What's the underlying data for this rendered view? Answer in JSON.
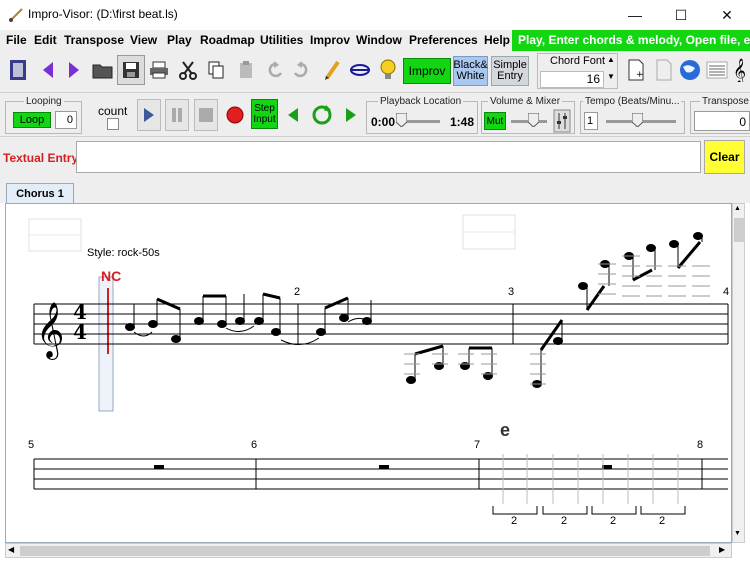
{
  "window": {
    "title": "Impro-Visor: (D:\\first beat.ls)",
    "minimize": "—",
    "maximize": "☐",
    "close": "✕"
  },
  "menu": {
    "items": [
      "File",
      "Edit",
      "Transpose",
      "View",
      "Play",
      "Roadmap",
      "Utilities",
      "Improv",
      "Window",
      "Preferences",
      "Help"
    ],
    "status": "Play, Enter chords & melody, Open file, etc."
  },
  "toolbar": {
    "improv_label": "Improv",
    "bw_label_1": "Black&",
    "bw_label_2": "White",
    "simple_label_1": "Simple",
    "simple_label_2": "Entry",
    "chord_font_label": "Chord Font",
    "chord_font_value": "16"
  },
  "playback": {
    "looping_label": "Looping",
    "loop_button": "Loop",
    "loop_count": "0",
    "count_label": "count",
    "step_input_1": "Step",
    "step_input_2": "Input",
    "location_label": "Playback Location",
    "time_current": "0:00",
    "time_total": "1:48",
    "volume_label": "Volume & Mixer",
    "mute_label": "Mut",
    "tempo_label": "Tempo (Beats/Minu...",
    "tempo_value": "1",
    "transpose_label": "Transpose",
    "transpose_value": "0"
  },
  "textual_entry": {
    "label": "Textual Entry",
    "value": "",
    "clear_button": "Clear"
  },
  "tabs": [
    "Chorus 1"
  ],
  "score": {
    "style_label": "Style: rock-50s",
    "chord_nc": "NC",
    "chord_e": "e",
    "time_sig_top": "4",
    "time_sig_bottom": "4",
    "bar_numbers_row1": [
      "2",
      "3",
      "4"
    ],
    "bar_numbers_row2": [
      "5",
      "6",
      "7",
      "8"
    ],
    "tuplet_numbers": [
      "2",
      "2",
      "2",
      "2"
    ]
  },
  "colors": {
    "status_green": "#13d613",
    "button_green": "#13d613",
    "bw_blue": "#a9c8f0",
    "clear_yellow": "#ffff33",
    "nc_red": "#d42020",
    "textual_entry_red": "#d42020",
    "arrow_purple": "#7a2fd6",
    "record_red": "#e02020"
  }
}
